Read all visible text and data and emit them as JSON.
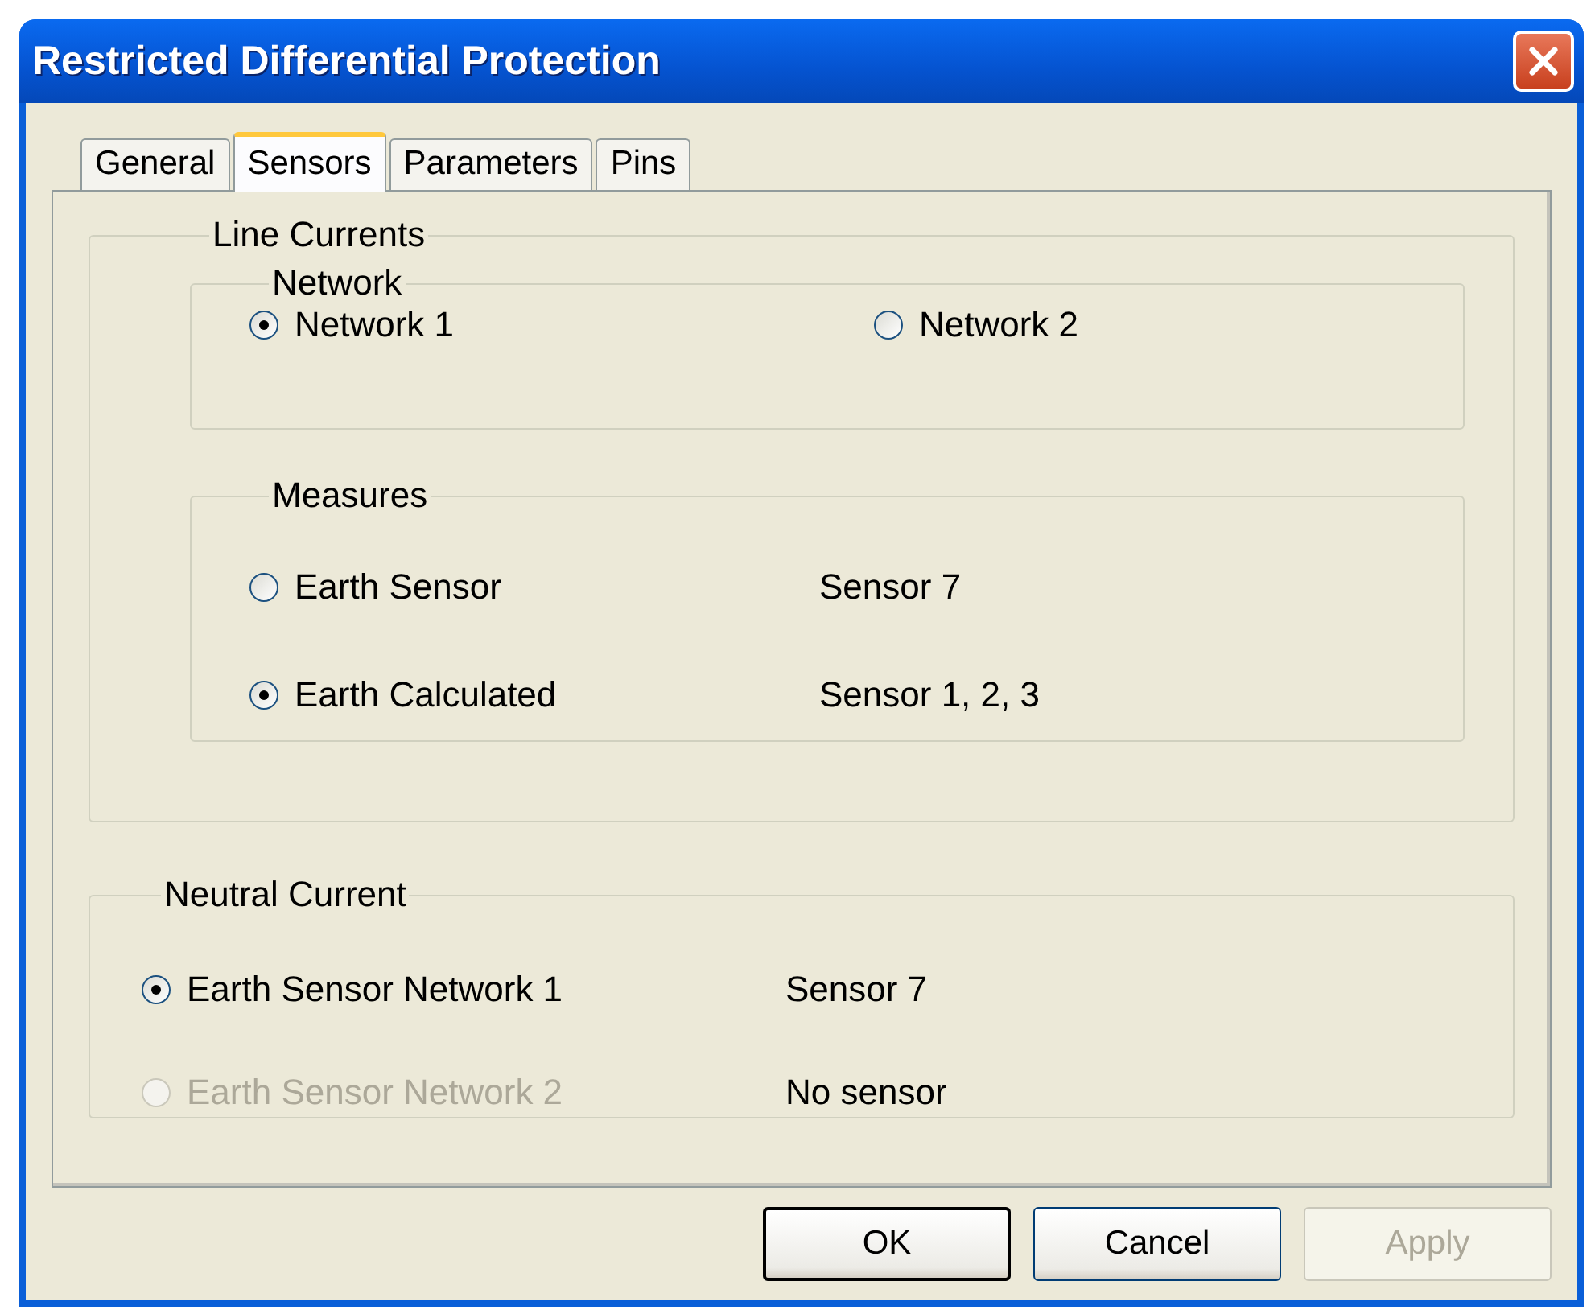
{
  "window": {
    "title": "Restricted Differential Protection"
  },
  "tabs": [
    {
      "label": "General",
      "selected": false
    },
    {
      "label": "Sensors",
      "selected": true
    },
    {
      "label": "Parameters",
      "selected": false
    },
    {
      "label": "Pins",
      "selected": false
    }
  ],
  "line_currents": {
    "title": "Line Currents",
    "network": {
      "title": "Network",
      "options": [
        {
          "label": "Network 1",
          "selected": true,
          "disabled": false
        },
        {
          "label": "Network 2",
          "selected": false,
          "disabled": false
        }
      ]
    },
    "measures": {
      "title": "Measures",
      "options": [
        {
          "label": "Earth Sensor",
          "selected": false,
          "disabled": false,
          "sensor": "Sensor 7"
        },
        {
          "label": "Earth Calculated",
          "selected": true,
          "disabled": false,
          "sensor": "Sensor 1, 2, 3"
        }
      ]
    }
  },
  "neutral_current": {
    "title": "Neutral Current",
    "options": [
      {
        "label": "Earth Sensor Network 1",
        "selected": true,
        "disabled": false,
        "sensor": "Sensor 7"
      },
      {
        "label": "Earth Sensor Network 2",
        "selected": false,
        "disabled": true,
        "sensor": "No sensor"
      }
    ]
  },
  "buttons": [
    {
      "label": "OK",
      "disabled": false,
      "default": true
    },
    {
      "label": "Cancel",
      "disabled": false,
      "default": false
    },
    {
      "label": "Apply",
      "disabled": true,
      "default": false
    }
  ]
}
